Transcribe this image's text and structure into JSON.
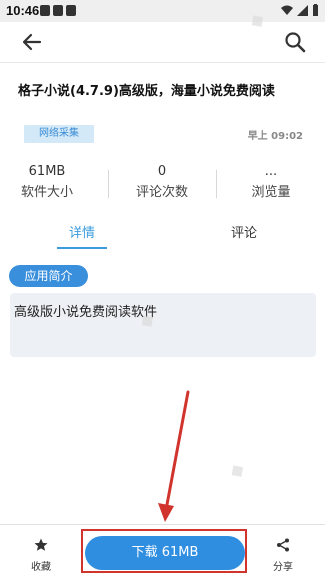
{
  "status_bar": {
    "time": "10:46"
  },
  "colors": {
    "accent": "#3a9cde",
    "download_button": "#2f8ee0",
    "tag_bg": "#d3e9f8",
    "highlight_frame": "#d0342c"
  },
  "app_bar": {
    "back_icon": "arrow-left-icon",
    "search_icon": "search-icon"
  },
  "article": {
    "title": "格子小说(4.7.9)高级版，海量小说免费阅读",
    "tag": "网络采集",
    "time": "早上 09:02"
  },
  "stats": [
    {
      "value": "61MB",
      "label": "软件大小"
    },
    {
      "value": "0",
      "label": "评论次数"
    },
    {
      "value": "...",
      "label": "浏览量"
    }
  ],
  "tabs": [
    {
      "label": "详情",
      "active": true
    },
    {
      "label": "评论",
      "active": false
    }
  ],
  "intro": {
    "pill": "应用简介",
    "text": "高级版小说免费阅读软件"
  },
  "bottom_bar": {
    "favorite_label": "收藏",
    "download_label": "下载 61MB",
    "share_label": "分享"
  }
}
